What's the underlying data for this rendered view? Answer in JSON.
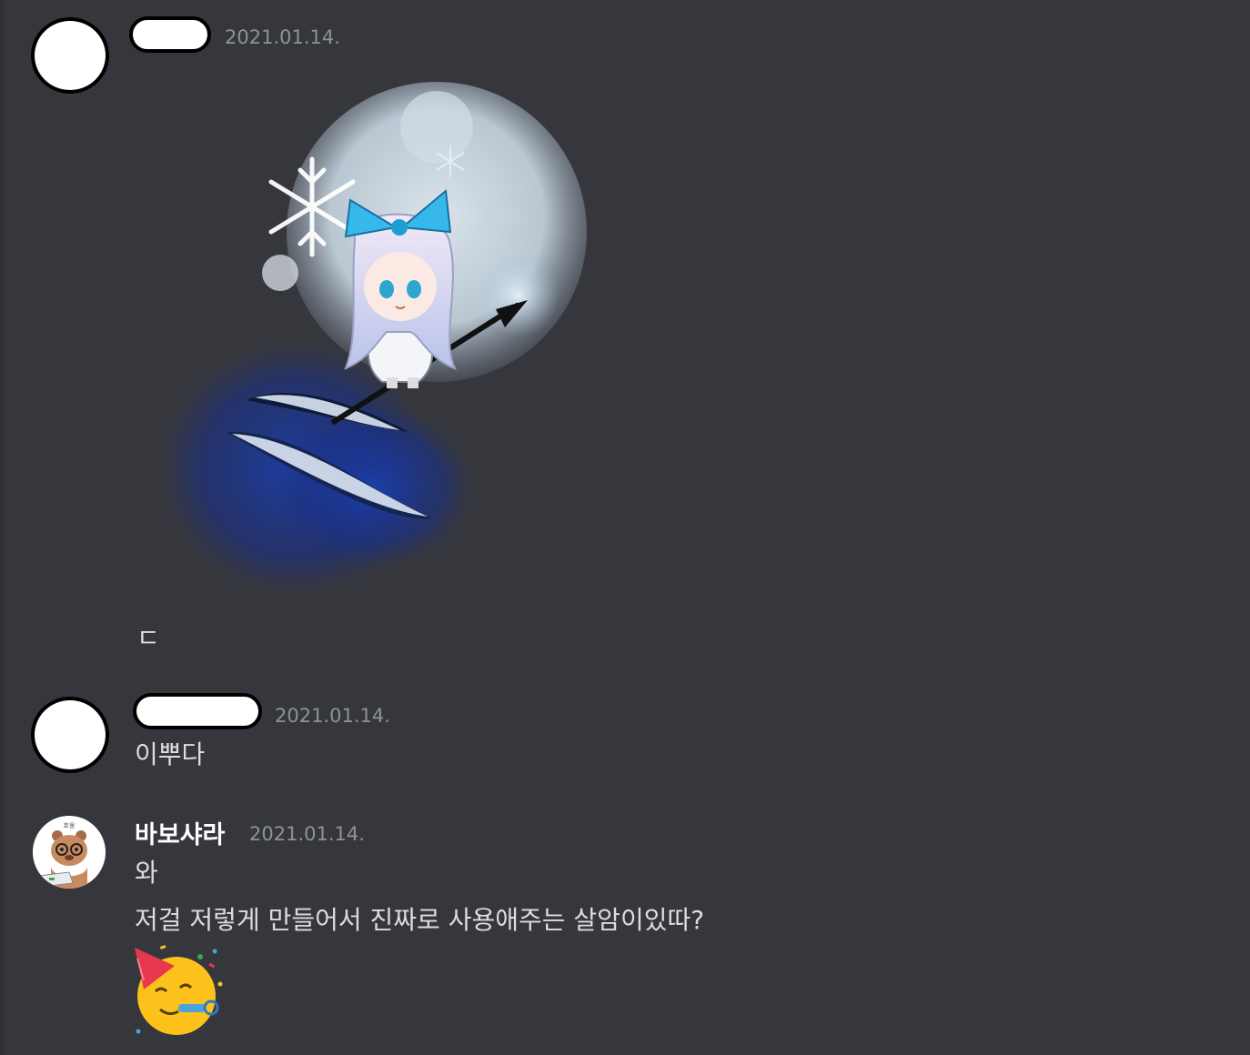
{
  "messages": [
    {
      "author": "",
      "timestamp": "2021.01.14.",
      "attachment": "maplestory-character-image",
      "lines": [
        "ㄷ"
      ]
    },
    {
      "author": "",
      "timestamp": "2021.01.14.",
      "lines": [
        "이뿌다"
      ]
    },
    {
      "author": "바보샤라",
      "timestamp": "2021.01.14.",
      "avatar_caption": "호옹",
      "lines": [
        "와",
        "저걸 저렇게 만들어서 진짜로 사용애주는 살암이있따?"
      ],
      "emoji": "partying-face"
    }
  ],
  "colors": {
    "background": "#36373d",
    "text": "#dcddde",
    "timestamp": "#8e9297",
    "username": "#ffffff"
  }
}
